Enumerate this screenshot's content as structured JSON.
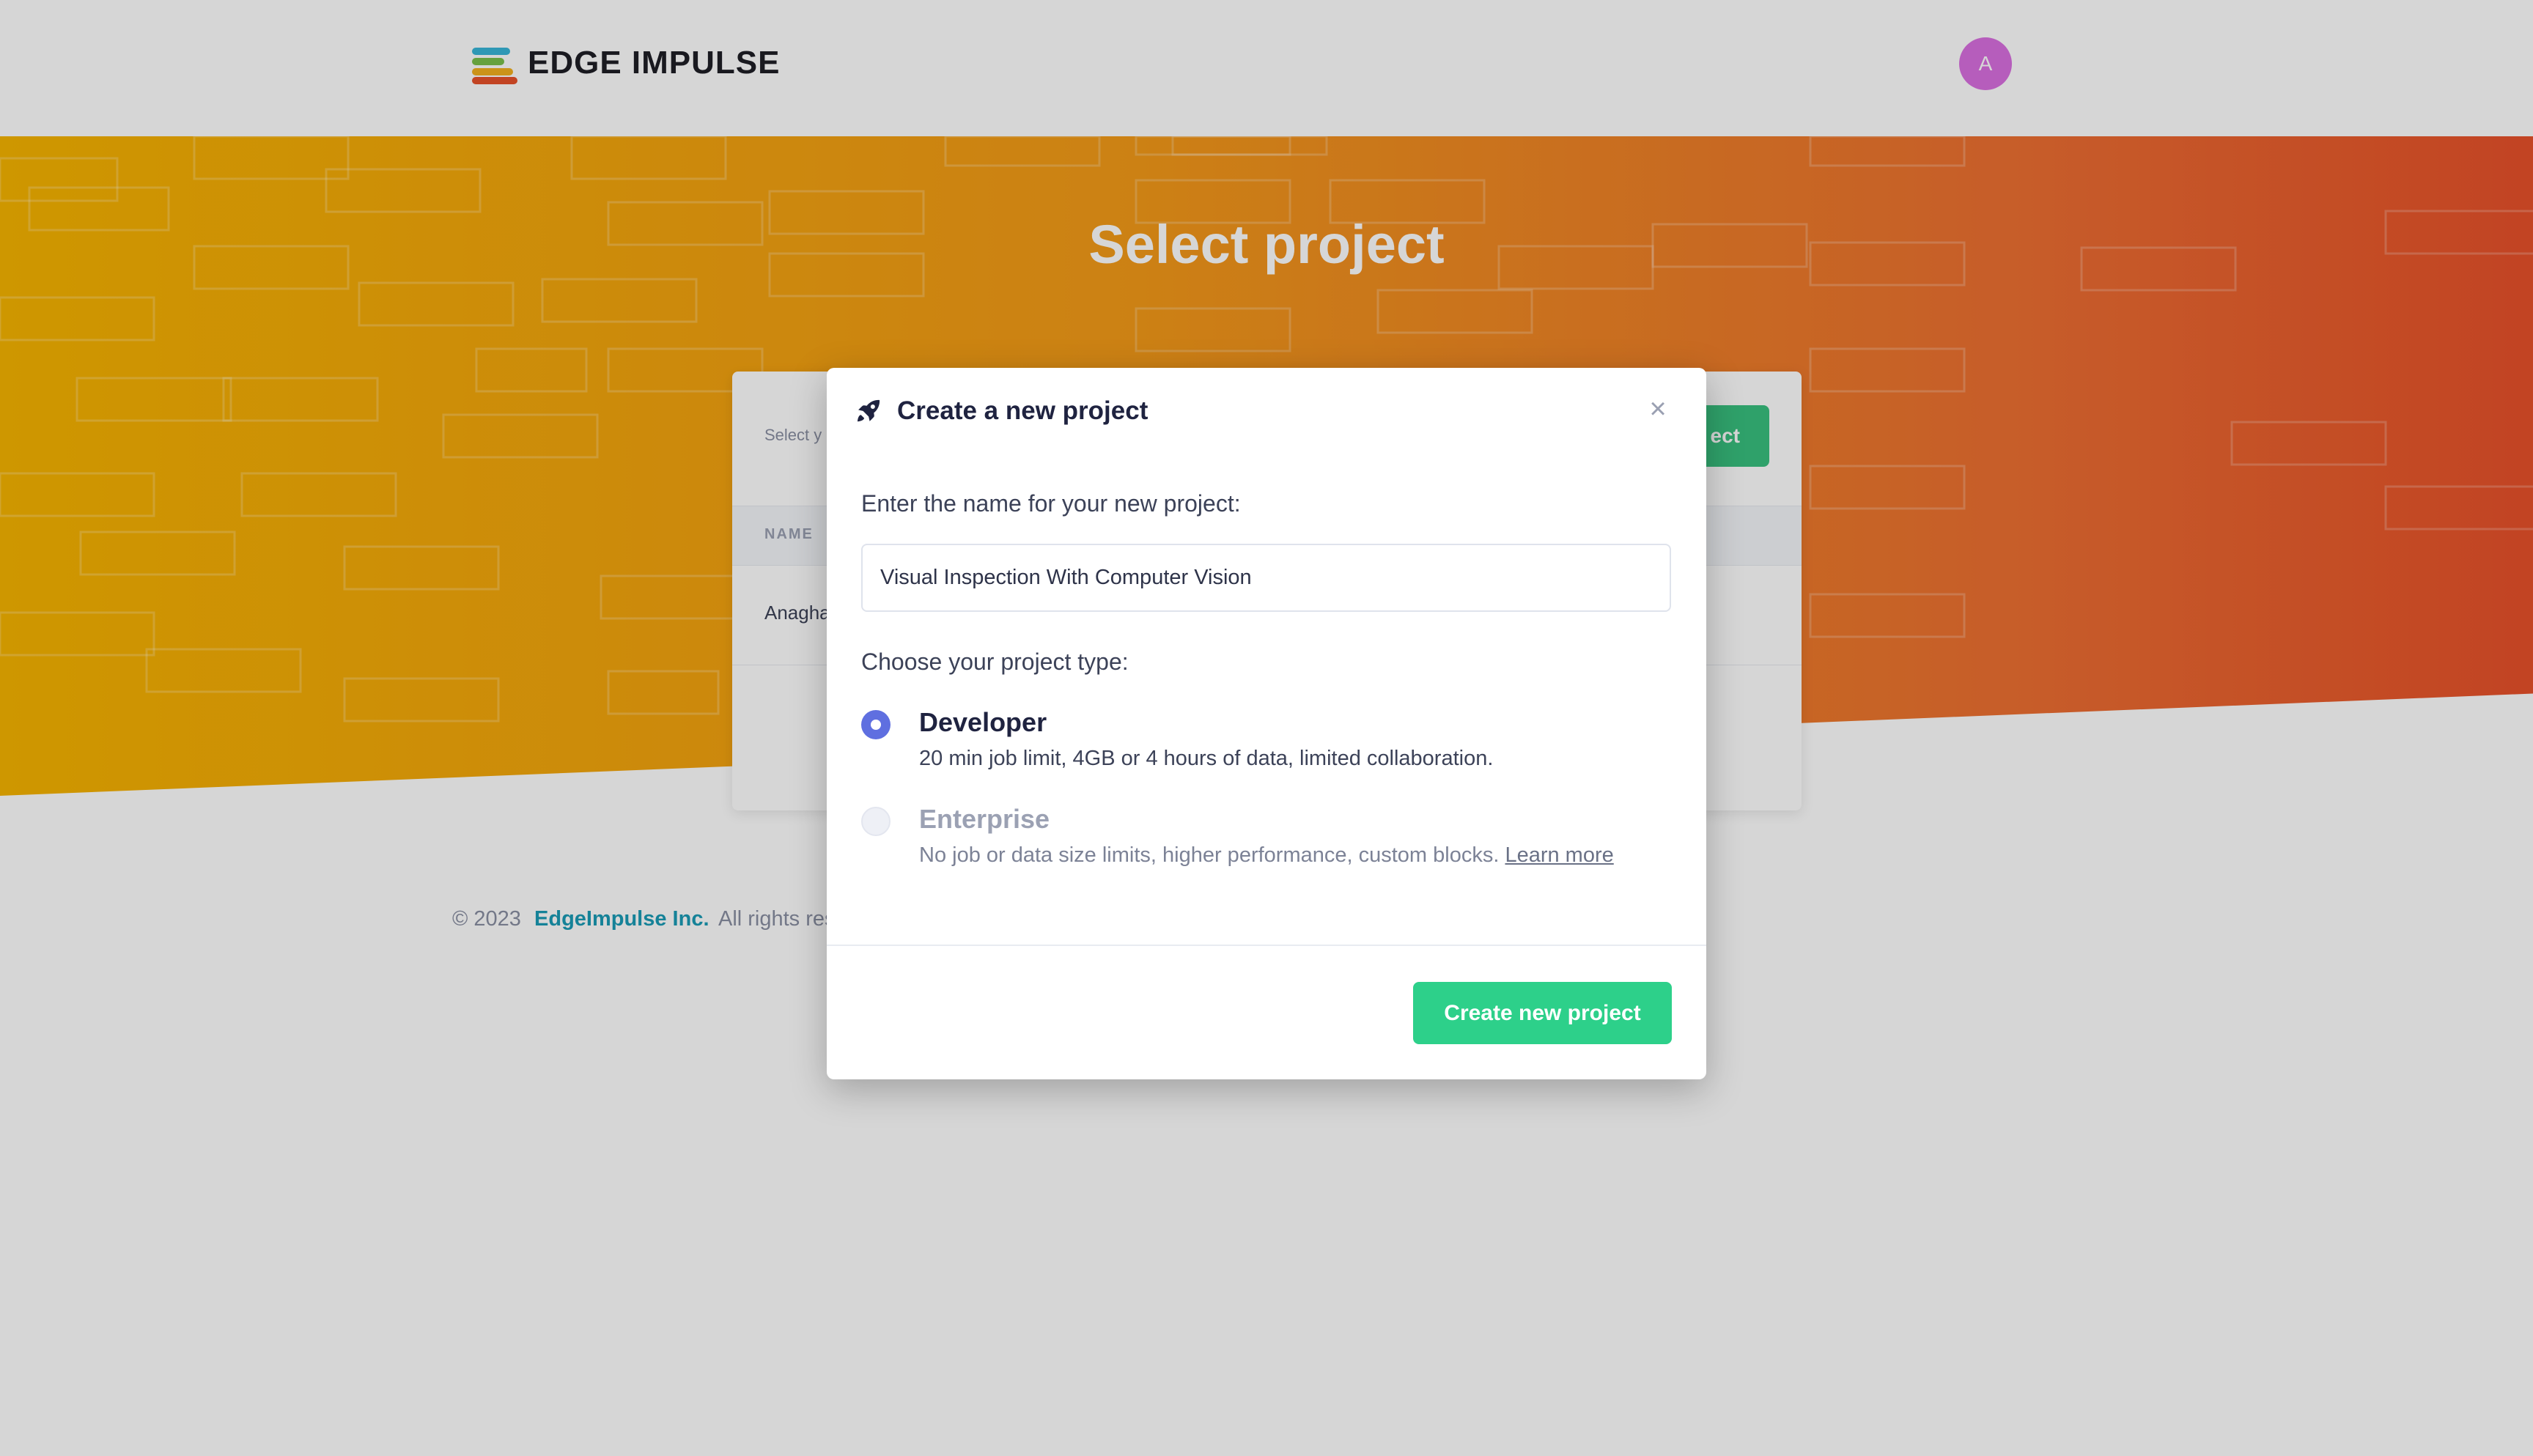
{
  "header": {
    "logo_text": "EDGE IMPULSE",
    "avatar_initial": "A"
  },
  "hero": {
    "title": "Select project"
  },
  "project_card": {
    "subtitle_fragment": "Select y",
    "button_fragment": "ect",
    "table_header": "NAME",
    "row_fragment": "Anagha"
  },
  "footer": {
    "copyright": "© 2023",
    "company_link": "EdgeImpulse Inc.",
    "rights_fragment": "All rights rese"
  },
  "modal": {
    "title": "Create a new project",
    "close_label": "×",
    "name_label": "Enter the name for your new project:",
    "name_value": "Visual Inspection With Computer Vision",
    "type_label": "Choose your project type:",
    "options": [
      {
        "title": "Developer",
        "description": "20 min job limit, 4GB or 4 hours of data, limited collaboration.",
        "selected": true
      },
      {
        "title": "Enterprise",
        "description": "No job or data size limits, higher performance, custom blocks.",
        "link_text": "Learn more",
        "selected": false
      }
    ],
    "submit_label": "Create new project"
  },
  "colors": {
    "brand_green": "#2dd08a",
    "radio_accent": "#5f6fe0",
    "link_teal": "#1a9bb5",
    "avatar": "#d96fe0",
    "hero_gradient_start": "#f6b400",
    "hero_gradient_end": "#e8512a"
  },
  "icons": {
    "modal_title_icon": "rocket-icon",
    "close_icon": "close-icon"
  }
}
